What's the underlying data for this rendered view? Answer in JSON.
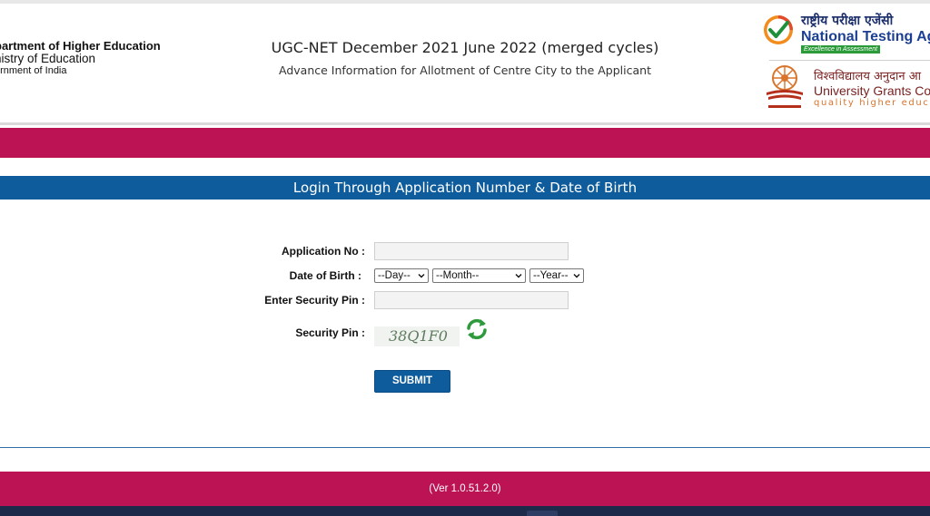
{
  "header": {
    "ministry": {
      "line1": "partment of Higher Education",
      "line2": "nistry of Education",
      "line3": "ernment of India"
    },
    "exam_title": "UGC-NET December 2021 June 2022 (merged cycles)",
    "exam_subtitle": "Advance Information for Allotment of Centre City to the Applicant",
    "nta": {
      "hindi": "राष्ट्रीय परीक्षा एजेंसी",
      "english": "National Testing Ag",
      "tagline": "Excellence in Assessment"
    },
    "ugc": {
      "hindi": "विश्वविद्यालय अनुदान आ",
      "english": "University Grants Cor",
      "tagline": "quality higher educatio"
    }
  },
  "login": {
    "heading": "Login Through Application Number & Date of Birth",
    "application_no_label": "Application No :",
    "application_no_value": "",
    "dob_label": "Date of Birth :",
    "day_selected": "--Day--",
    "month_selected": "--Month--",
    "year_selected": "--Year--",
    "security_pin_input_label": "Enter Security Pin :",
    "security_pin_input_value": "",
    "security_pin_label": "Security Pin :",
    "captcha_text": "38Q1F0",
    "submit_label": "SUBMIT"
  },
  "footer": {
    "version": "(Ver 1.0.51.2.0)"
  },
  "colors": {
    "brand_magenta": "#bb1354",
    "brand_blue": "#0e5c9c",
    "nta_green": "#2b9b3a"
  },
  "icons": {
    "nta_logo": "nta-check-icon",
    "ugc_logo": "ugc-emblem-icon",
    "refresh": "refresh-icon",
    "dropdown": "chevron-down-icon"
  }
}
